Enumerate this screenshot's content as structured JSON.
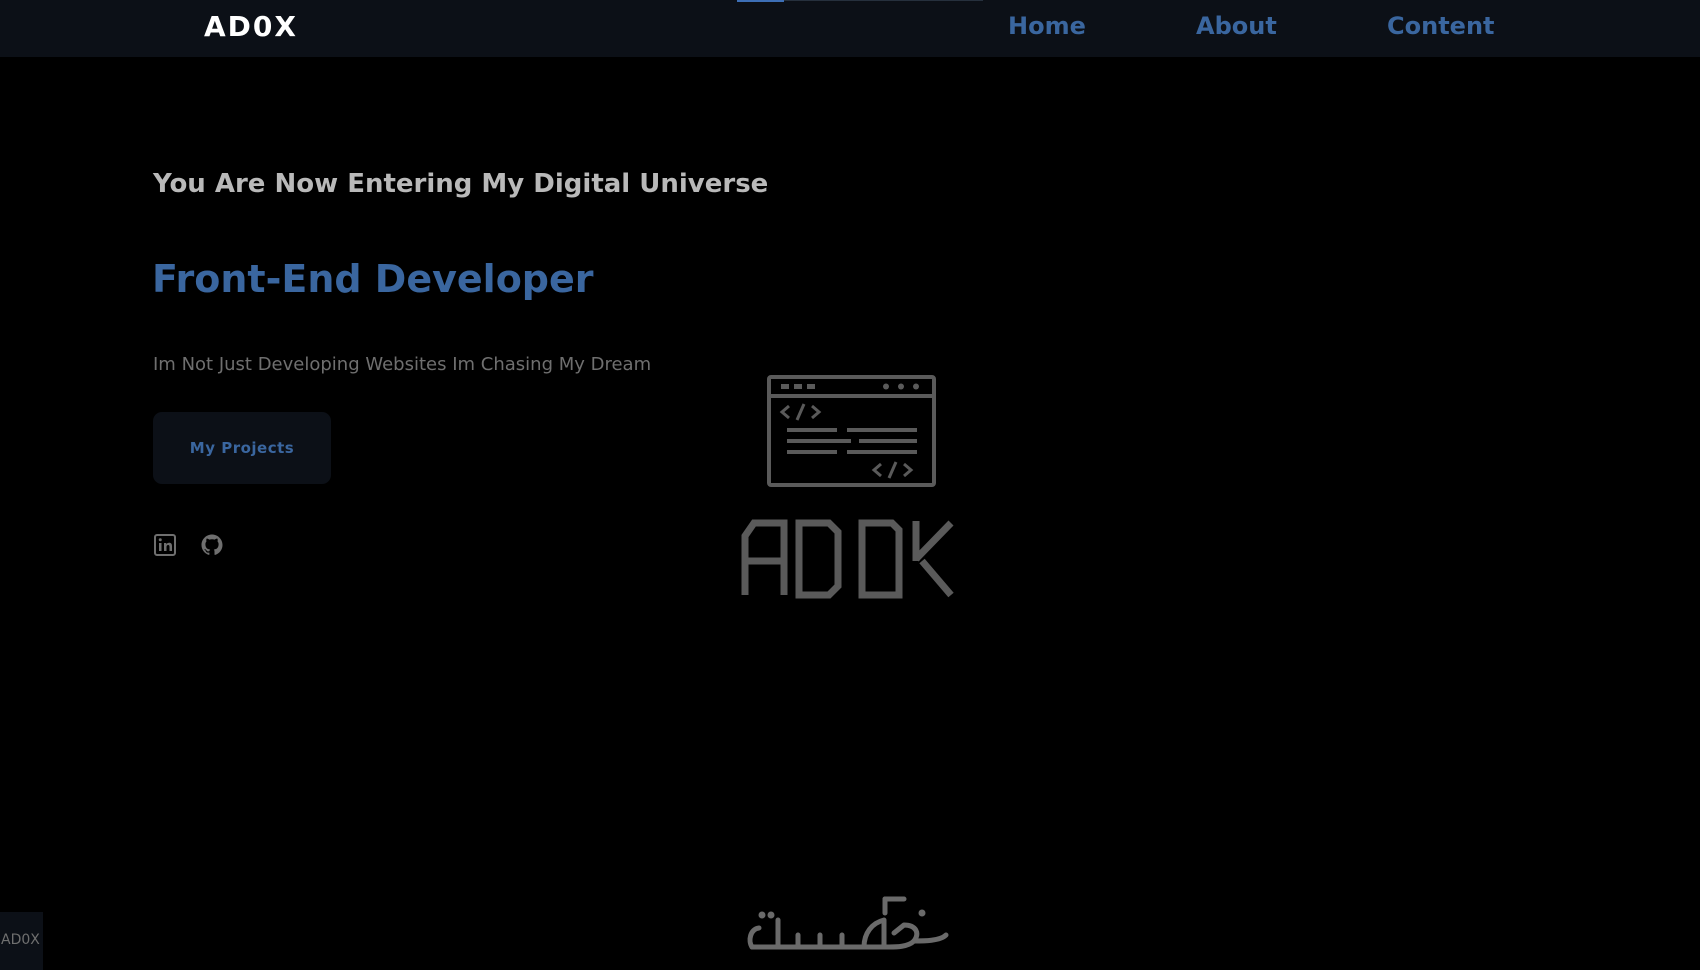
{
  "navbar": {
    "brand": "AD0X",
    "scroll_progress": 0.19,
    "links": [
      {
        "label": "Home"
      },
      {
        "label": "About"
      },
      {
        "label": "Content"
      }
    ]
  },
  "hero": {
    "eyebrow": "You Are Now Entering My Digital Universe",
    "role": "Front-End Developer",
    "tagline": "Im Not Just Developing Websites Im Chasing My Dream",
    "cta_label": "My Projects",
    "socials": [
      {
        "icon": "linkedin-icon"
      },
      {
        "icon": "github-icon"
      }
    ]
  },
  "emblem": {
    "icon": "code-window-icon",
    "logo_text": "ADOX"
  },
  "footer": {
    "corner_tag": "AD0X",
    "watermark": "خمسات"
  },
  "colors": {
    "background": "#000000",
    "navbar": "#0c1017",
    "accent": "#3a669f",
    "heading": "#b9b9b9",
    "muted": "#6f6f6f",
    "emblem": "#5a5a5a"
  }
}
